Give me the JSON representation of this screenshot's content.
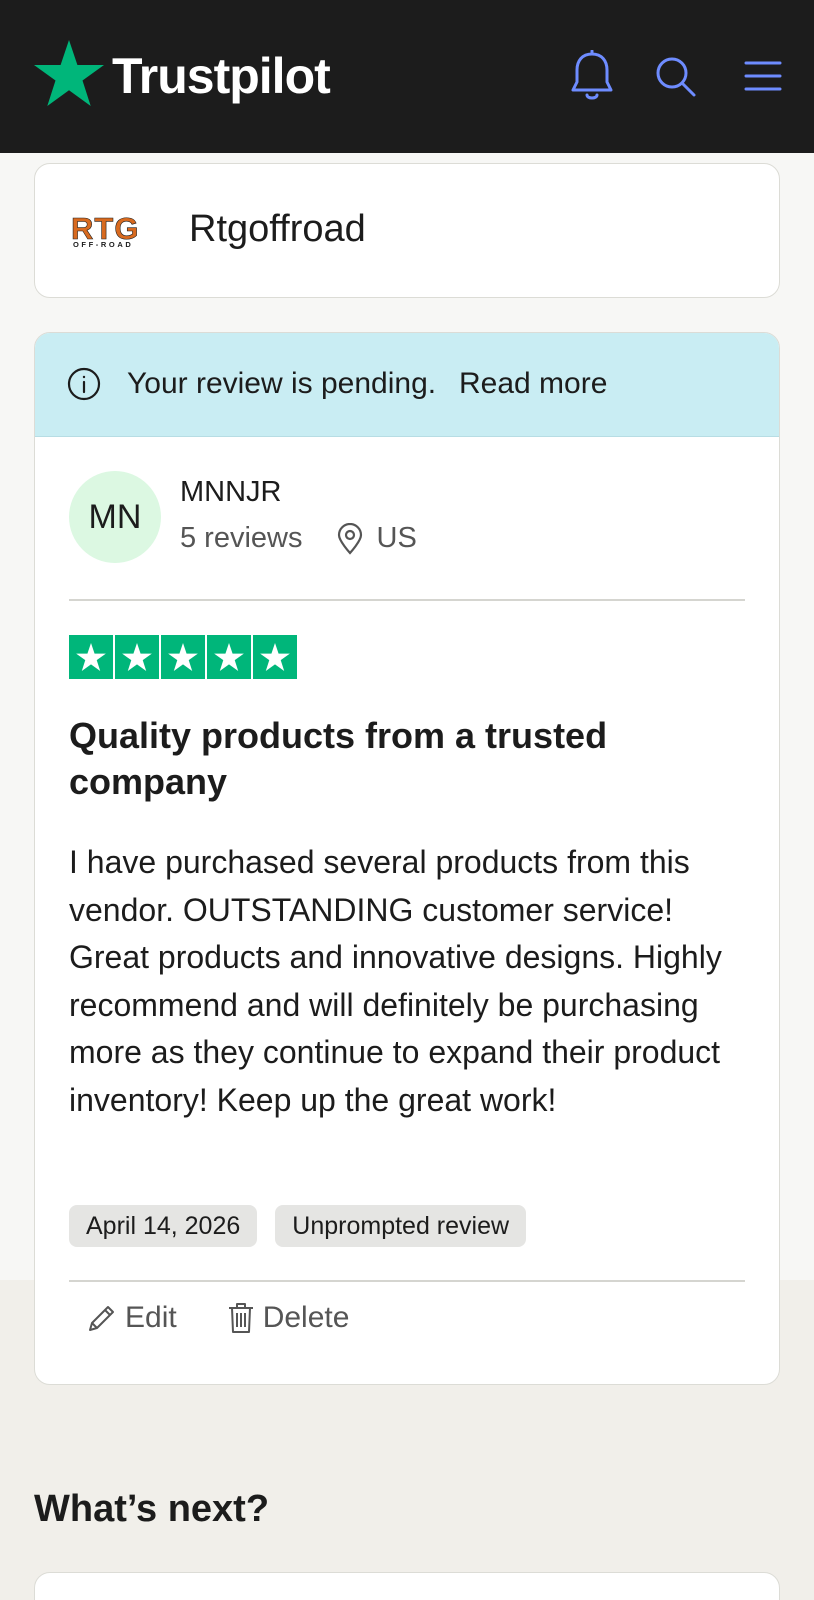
{
  "header": {
    "brand": "Trustpilot",
    "icons": [
      "notification-bell-icon",
      "search-icon",
      "menu-icon"
    ],
    "accent_color": "#00b67a",
    "icon_color": "#6e8cff"
  },
  "company": {
    "logo_text": "RTG",
    "logo_subtext": "OFF-ROAD",
    "name": "Rtgoffroad"
  },
  "banner": {
    "message": "Your review is pending.",
    "link": "Read more"
  },
  "reviewer": {
    "initials": "MN",
    "name": "MNNJR",
    "reviews": "5 reviews",
    "country": "US"
  },
  "review": {
    "rating": 5,
    "max_rating": 5,
    "title": "Quality products from a trusted company",
    "body": "I have purchased several products from this vendor.  OUTSTANDING customer service!  Great products and innovative designs.  Highly recommend and will definitely be purchasing more as they continue to expand their product inventory!  Keep up the great work!",
    "date": "April 14, 2026",
    "label": "Unprompted review"
  },
  "actions": {
    "edit": "Edit",
    "delete": "Delete"
  },
  "next": {
    "heading": "What’s next?"
  }
}
